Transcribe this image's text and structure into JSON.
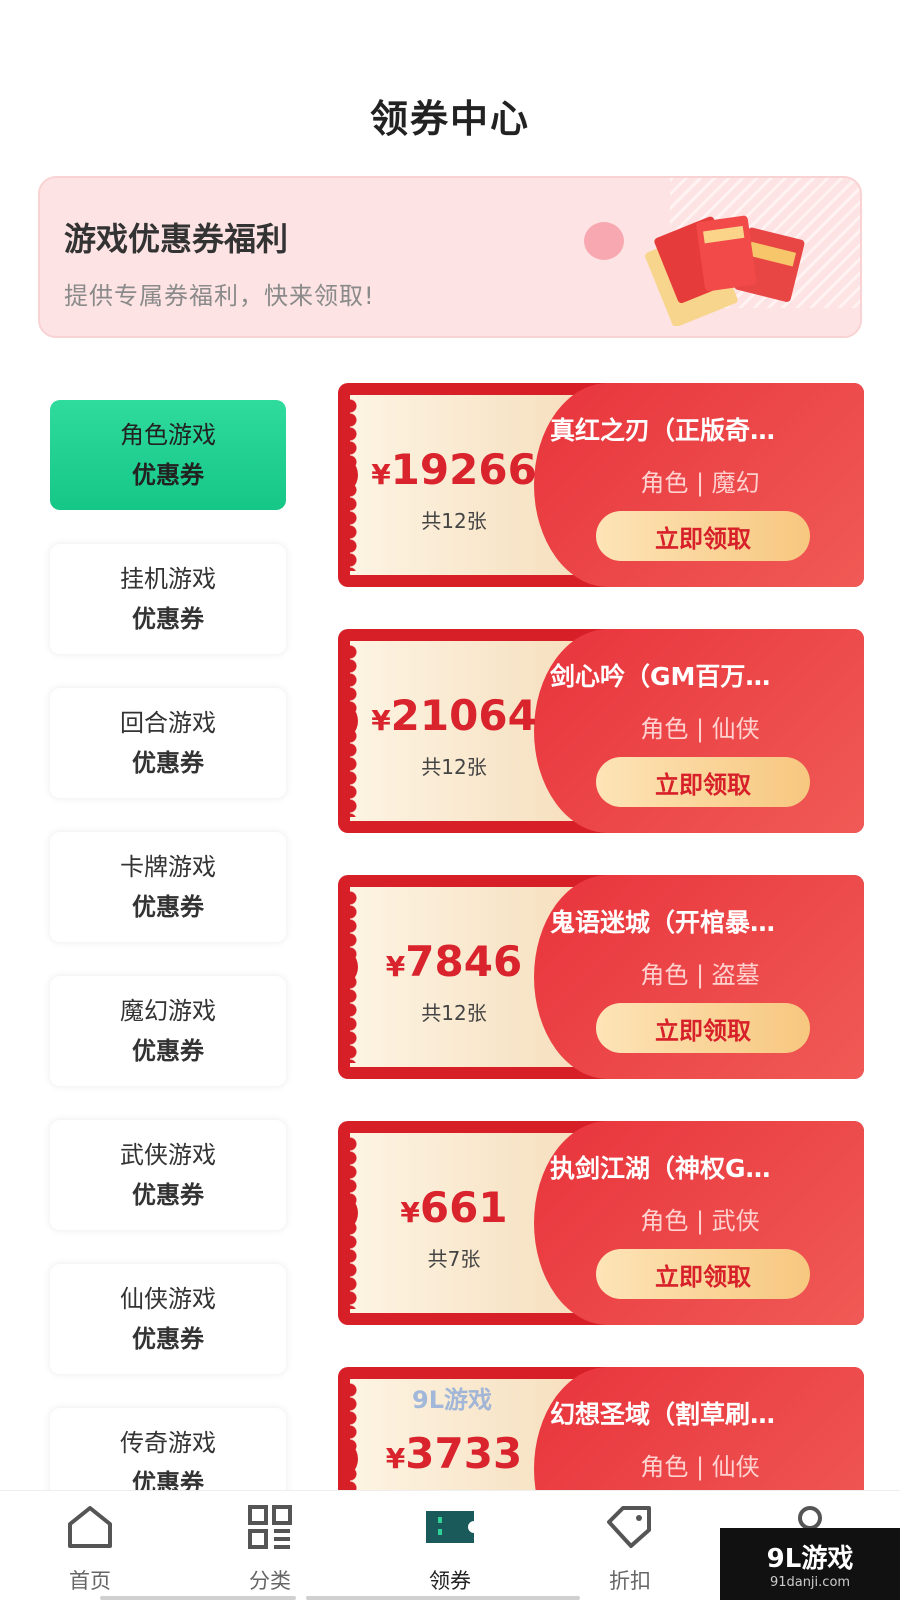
{
  "header": {
    "title": "领券中心"
  },
  "banner": {
    "title": "游戏优惠券福利",
    "subtitle": "提供专属券福利，快来领取!"
  },
  "sidebar": {
    "items": [
      {
        "line1": "角色游戏",
        "line2": "优惠券",
        "active": true
      },
      {
        "line1": "挂机游戏",
        "line2": "优惠券"
      },
      {
        "line1": "回合游戏",
        "line2": "优惠券"
      },
      {
        "line1": "卡牌游戏",
        "line2": "优惠券"
      },
      {
        "line1": "魔幻游戏",
        "line2": "优惠券"
      },
      {
        "line1": "武侠游戏",
        "line2": "优惠券"
      },
      {
        "line1": "仙侠游戏",
        "line2": "优惠券"
      },
      {
        "line1": "传奇游戏",
        "line2": "优惠券"
      }
    ]
  },
  "coupons": [
    {
      "amount": "19266",
      "count": "共12张",
      "name": "真红之刃（正版奇…",
      "tags": "角色 | 魔幻",
      "button": "立即领取"
    },
    {
      "amount": "21064",
      "count": "共12张",
      "name": "剑心吟（GM百万…",
      "tags": "角色 | 仙侠",
      "button": "立即领取"
    },
    {
      "amount": "7846",
      "count": "共12张",
      "name": "鬼语迷城（开棺暴…",
      "tags": "角色 | 盗墓",
      "button": "立即领取"
    },
    {
      "amount": "661",
      "count": "共7张",
      "name": "执剑江湖（神权G…",
      "tags": "角色 | 武侠",
      "button": "立即领取"
    },
    {
      "amount": "3733",
      "count": "",
      "name": "幻想圣域（割草刷…",
      "tags": "角色 | 仙侠",
      "button": ""
    }
  ],
  "currency_symbol": "¥",
  "tabbar": {
    "items": [
      {
        "label": "首页",
        "icon": "home-icon"
      },
      {
        "label": "分类",
        "icon": "grid-icon"
      },
      {
        "label": "领券",
        "icon": "ticket-icon",
        "active": true
      },
      {
        "label": "折扣",
        "icon": "tag-icon"
      },
      {
        "label": "",
        "icon": "user-icon"
      }
    ]
  },
  "watermark": {
    "text": "9L游戏",
    "url": "91danji.com",
    "mid_text": "9L游戏"
  },
  "colors": {
    "accent_red": "#d71f28",
    "active_green": "#1fcf8f",
    "gold": "#f7c77f"
  }
}
